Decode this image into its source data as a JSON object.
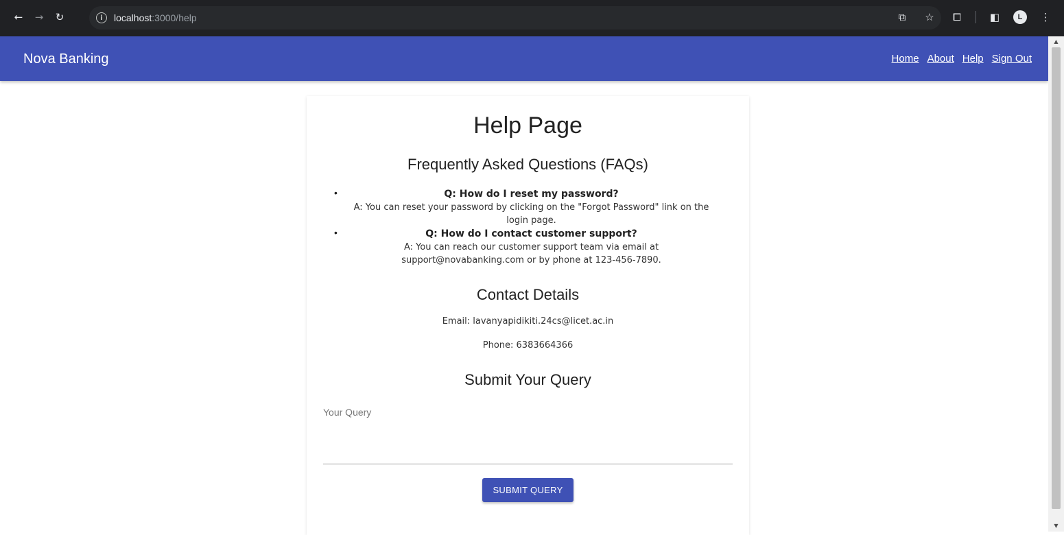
{
  "browser": {
    "url_host": "localhost",
    "url_path": ":3000/help",
    "back_icon": "back-arrow-icon",
    "forward_icon": "forward-arrow-icon",
    "reload_icon": "reload-icon"
  },
  "navbar": {
    "brand": "Nova Banking",
    "links": [
      "Home",
      "About",
      "Help",
      "Sign Out"
    ],
    "color": "#3f51b5"
  },
  "page": {
    "title": "Help Page",
    "faq": {
      "heading": "Frequently Asked Questions (FAQs)",
      "items": [
        {
          "question": "Q: How do I reset my password?",
          "answer": "A: You can reset your password by clicking on the \"Forgot Password\" link on the login page."
        },
        {
          "question": "Q: How do I contact customer support?",
          "answer": "A: You can reach our customer support team via email at support@novabanking.com or by phone at 123-456-7890."
        }
      ]
    },
    "contact": {
      "heading": "Contact Details",
      "email": "Email: lavanyapidikiti.24cs@licet.ac.in",
      "phone": "Phone: 6383664366"
    },
    "query": {
      "heading": "Submit Your Query",
      "placeholder": "Your Query",
      "value": "",
      "submit_label": "SUBMIT QUERY"
    }
  }
}
